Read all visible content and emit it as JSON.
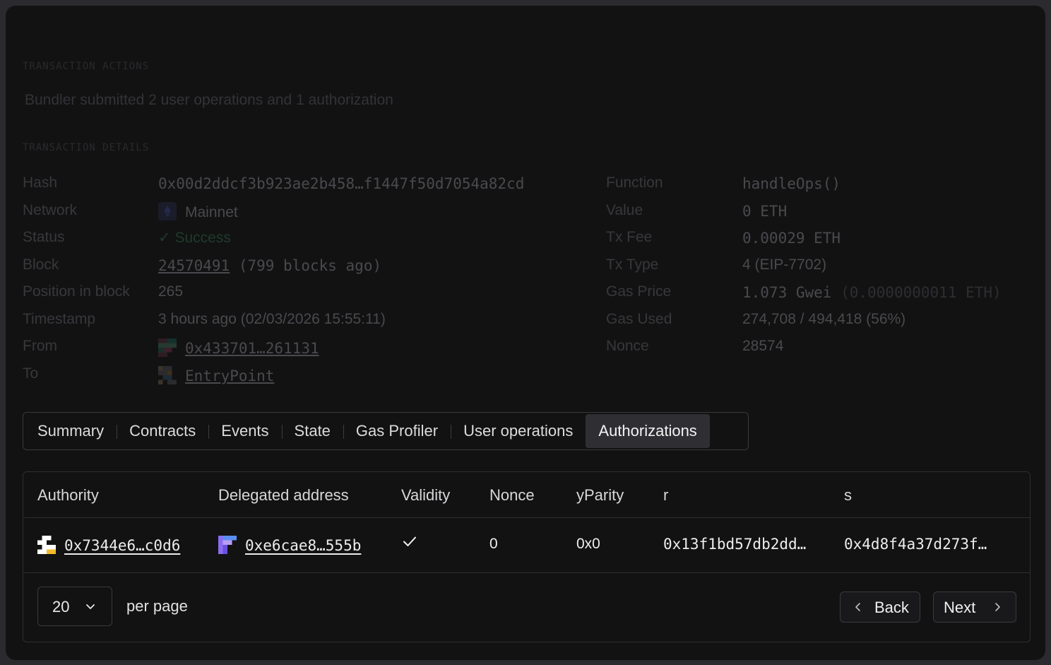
{
  "sections": {
    "actions_title": "TRANSACTION ACTIONS",
    "actions_text": "Bundler submitted 2 user operations and 1 authorization",
    "details_title": "TRANSACTION DETAILS"
  },
  "details_left": {
    "hash_label": "Hash",
    "hash_value": "0x00d2ddcf3b923ae2b458…f1447f50d7054a82cd",
    "network_label": "Network",
    "network_value": "Mainnet",
    "status_label": "Status",
    "status_value": "Success",
    "block_label": "Block",
    "block_value": "24570491",
    "block_ago": "(799 blocks ago)",
    "position_label": "Position in block",
    "position_value": "265",
    "timestamp_label": "Timestamp",
    "timestamp_value": "3 hours ago (02/03/2026 15:55:11)",
    "from_label": "From",
    "from_value": "0x433701…261131",
    "to_label": "To",
    "to_value": "EntryPoint"
  },
  "details_right": {
    "function_label": "Function",
    "function_value": "handleOps()",
    "value_label": "Value",
    "value_value": "0 ETH",
    "fee_label": "Tx Fee",
    "fee_value": "0.00029 ETH",
    "type_label": "Tx Type",
    "type_value": "4 (EIP-7702)",
    "gasprice_label": "Gas Price",
    "gasprice_value": "1.073 Gwei",
    "gasprice_eth": "(0.0000000011 ETH)",
    "gasused_label": "Gas Used",
    "gasused_value": "274,708 / 494,418 (56%)",
    "nonce_label": "Nonce",
    "nonce_value": "28574"
  },
  "tabs": [
    "Summary",
    "Contracts",
    "Events",
    "State",
    "Gas Profiler",
    "User operations",
    "Authorizations"
  ],
  "active_tab": "Authorizations",
  "table": {
    "headers": [
      "Authority",
      "Delegated address",
      "Validity",
      "Nonce",
      "yParity",
      "r",
      "s"
    ],
    "rows": [
      {
        "authority": "0x7344e6…c0d6",
        "delegated": "0xe6cae8…555b",
        "validity_icon": "check-icon",
        "nonce": "0",
        "yparity": "0x0",
        "r": "0x13f1bd57db2dd…",
        "s": "0x4d8f4a37d273f…"
      }
    ]
  },
  "pagination": {
    "per_page": "20",
    "per_page_label": "per page",
    "back": "Back",
    "next": "Next"
  }
}
